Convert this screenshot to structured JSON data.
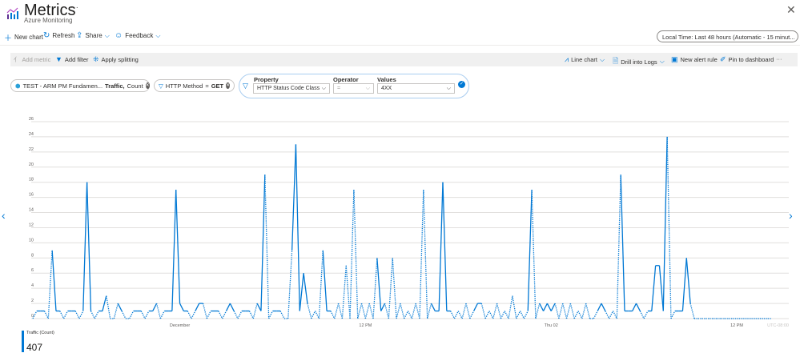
{
  "header": {
    "title": "Metrics",
    "subtitle": "Azure Monitoring",
    "more": "···",
    "close": "✕"
  },
  "commands": [
    {
      "label": "New chart",
      "icon": "plus-icon"
    },
    {
      "label": "Refresh",
      "icon": "refresh-icon"
    },
    {
      "label": "Share",
      "icon": "share-icon"
    },
    {
      "label": "Feedback",
      "icon": "smiley-icon"
    }
  ],
  "time_range": "Local Time: Last 48 hours (Automatic - 15 minut...",
  "toolbar": {
    "add_metric": "Add metric",
    "add_filter": "Add filter",
    "apply_splitting": "Apply splitting",
    "line_chart": "Line chart",
    "drill_logs": "Drill into Logs",
    "new_alert": "New alert rule",
    "pin": "Pin to dashboard",
    "more": "···"
  },
  "pills": {
    "metric_resource": "TEST - ARM PM Fundamen...",
    "metric_name": "Traffic,",
    "metric_agg": "Count",
    "filter_name": "HTTP Method",
    "filter_op": "=",
    "filter_value": "GET"
  },
  "filter_editor": {
    "property_label": "Property",
    "operator_label": "Operator",
    "values_label": "Values",
    "property": "HTTP Status Code Class",
    "operator": "=",
    "value": "4XX"
  },
  "legend": {
    "name": "Traffic (Count)",
    "value": "407"
  },
  "colors": {
    "accent": "#0078d4"
  },
  "chart_data": {
    "type": "line",
    "ylim": [
      0,
      26
    ],
    "yticks": [
      0,
      2,
      4,
      6,
      8,
      10,
      12,
      14,
      16,
      18,
      20,
      22,
      24,
      26
    ],
    "grid": true,
    "interval": "15 minutes",
    "timezone": "UTC-08:00",
    "xticks": [
      {
        "label": "December",
        "at_point": 38
      },
      {
        "label": "12 PM",
        "at_point": 86
      },
      {
        "label": "Thu 02",
        "at_point": 134
      },
      {
        "label": "12 PM",
        "at_point": 182
      }
    ],
    "series": [
      {
        "name": "Traffic (Count)",
        "values": [
          0,
          1,
          1,
          1,
          0,
          9,
          1,
          1,
          0,
          1,
          1,
          1,
          0,
          1,
          18,
          1,
          0,
          1,
          1,
          3,
          0,
          0,
          2,
          1,
          0,
          0,
          1,
          1,
          1,
          0,
          1,
          1,
          2,
          0,
          1,
          1,
          1,
          17,
          2,
          1,
          1,
          0,
          1,
          2,
          2,
          0,
          1,
          1,
          1,
          0,
          1,
          2,
          1,
          0,
          1,
          1,
          1,
          0,
          2,
          1,
          19,
          0,
          1,
          1,
          1,
          0,
          0,
          9,
          23,
          1,
          6,
          2,
          0,
          1,
          0,
          9,
          1,
          1,
          0,
          2,
          0,
          7,
          0,
          17,
          0,
          2,
          0,
          2,
          0,
          8,
          1,
          2,
          0,
          8,
          0,
          2,
          0,
          1,
          0,
          2,
          0,
          17,
          0,
          2,
          1,
          1,
          18,
          1,
          1,
          0,
          1,
          0,
          2,
          0,
          1,
          2,
          2,
          0,
          1,
          0,
          2,
          0,
          1,
          0,
          3,
          0,
          1,
          0,
          1,
          17,
          0,
          2,
          1,
          2,
          1,
          2,
          0,
          2,
          0,
          2,
          0,
          1,
          0,
          2,
          0,
          0,
          1,
          2,
          1,
          0,
          1,
          0,
          19,
          1,
          1,
          1,
          2,
          1,
          0,
          1,
          1,
          7,
          7,
          1,
          24,
          0,
          1,
          1,
          1,
          8,
          2,
          0,
          0,
          0,
          0,
          0,
          0,
          0,
          0,
          0,
          0,
          0,
          0,
          0,
          0,
          0,
          0,
          0,
          0,
          0,
          0,
          0
        ]
      }
    ]
  }
}
